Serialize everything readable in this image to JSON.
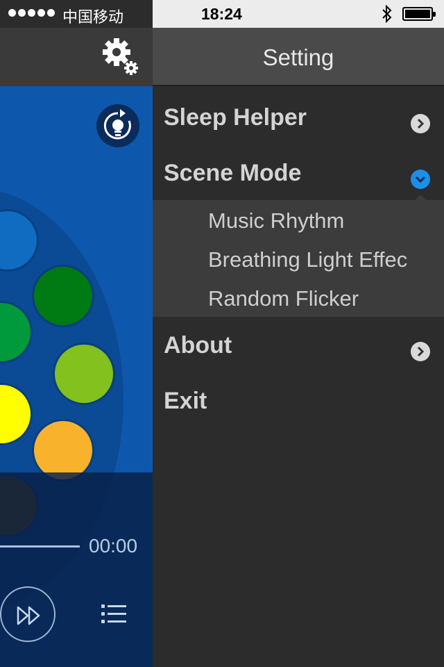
{
  "status_bar": {
    "carrier": "中国移动",
    "time": "18:24"
  },
  "player": {
    "elapsed": "00:00"
  },
  "circles": [
    {
      "color": "#0f6cc0"
    },
    {
      "color": "#007a13"
    },
    {
      "color": "#00993b"
    },
    {
      "color": "#82c11e"
    },
    {
      "color": "#ffff00"
    },
    {
      "color": "#f9b22b"
    },
    {
      "color": "#6b4800"
    }
  ],
  "settings": {
    "title": "Setting",
    "items": [
      {
        "label": "Sleep Helper"
      },
      {
        "label": "Scene Mode"
      },
      {
        "label": "About"
      },
      {
        "label": "Exit"
      }
    ],
    "scene_modes": [
      {
        "label": "Music Rhythm"
      },
      {
        "label": "Breathing Light Effec"
      },
      {
        "label": "Random Flicker"
      }
    ]
  },
  "icons": [
    "gear-icon",
    "bulb-refresh-icon",
    "fast-forward-icon",
    "list-icon",
    "chevron-right-icon",
    "chevron-down-icon",
    "bluetooth-icon",
    "battery-icon"
  ]
}
